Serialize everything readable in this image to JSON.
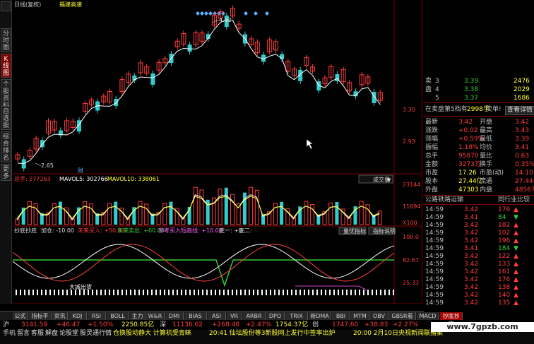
{
  "window": {
    "title_prefix": "日线(复权)",
    "stock_name": "福建高速"
  },
  "side_tabs": [
    {
      "label": "分\n时\n图",
      "active": false
    },
    {
      "label": "K\n线\n图",
      "active": true
    },
    {
      "label": "个\n股\n资\n料",
      "active": false
    },
    {
      "label": "自\n选\n股",
      "active": false
    },
    {
      "label": "综\n合\n排\n名",
      "active": false
    },
    {
      "label": "更\n多",
      "active": false
    }
  ],
  "price_axis": {
    "labels": [
      "4.32",
      "3.30",
      "2.93",
      "2.65"
    ],
    "right_labels": [
      "3.30",
      "2.93"
    ]
  },
  "volume_panel": {
    "header": "总手: 277263  MAVOL5: 302766  MAVOL10: 338061",
    "total_label": "总手: 277263",
    "ma5_label": "MAVOL5: 302766",
    "ma10_label": "MAVOL10: 338061",
    "axis": [
      "23144",
      "11694",
      "X100"
    ],
    "dropdown": "成交量",
    "badge": "财"
  },
  "indicator_panel": {
    "name": "抄底抄底",
    "add_label": "加仓: -10.00",
    "buy1": "未来买入: +50.00",
    "sell1": "未来卖出: +60.00",
    "buy2": "参考买入短趋线: +10.00",
    "low1": "底一: +0",
    "low2": "底二:",
    "btn_params": "量优指标",
    "btn_help": "指标说明",
    "axis": [
      "100.0",
      "62.67",
      "25.33"
    ],
    "annotation": "大城出货"
  },
  "x_axis": {
    "labels": [
      "10",
      "11",
      "12",
      "01",
      "02"
    ]
  },
  "right_panel": {
    "ask": [
      {
        "side": "卖",
        "level": "3",
        "price": "3.39",
        "vol": "2476"
      },
      {
        "side": "",
        "level": "4",
        "price": "3.38",
        "vol": "2029"
      },
      {
        "side": "",
        "level": "5",
        "price": "3.37",
        "vol": "1686"
      }
    ],
    "queue": {
      "text": "在卖盘第5档有",
      "count": "2998手",
      "sell1": "卖单!",
      "btn": "查看详情"
    },
    "stats": [
      {
        "l1": "最新",
        "v1": "3.42",
        "l2": "开盘",
        "v2": "3.42"
      },
      {
        "l1": "涨跌",
        "v1": "+0.02",
        "l2": "最高",
        "v2": "3.43"
      },
      {
        "l1": "涨幅",
        "v1": "+0.59%",
        "l2": "最低",
        "v2": "3.39"
      },
      {
        "l1": "振幅",
        "v1": "1.18%",
        "l2": "均价",
        "v2": "3.41"
      },
      {
        "l1": "总手",
        "v1": "95870",
        "l2": "量比",
        "v2": "0.63"
      },
      {
        "l1": "金额",
        "v1": "3273万",
        "l2": "换手",
        "v2": "0.35%"
      },
      {
        "l1": "市盈",
        "v1": "17.26",
        "l2": "市盈(动)",
        "v2": "14.10"
      },
      {
        "l1": "股本",
        "v1": "27.44亿",
        "l2": "流通",
        "v2": "27.44亿"
      },
      {
        "l1": "外盘",
        "v1": "47303",
        "l2": "内盘",
        "v2": "48567"
      }
    ],
    "industry": {
      "name": "公路铁路运输",
      "compare": "同行业比较"
    },
    "ticks": [
      {
        "time": "14:59",
        "price": "3.42",
        "vol": "176",
        "dir": "up"
      },
      {
        "time": "14:59",
        "price": "3.41",
        "vol": "84",
        "dir": "down"
      },
      {
        "time": "14:59",
        "price": "3.42",
        "vol": "182",
        "dir": "up"
      },
      {
        "time": "14:59",
        "price": "3.42",
        "vol": "102",
        "dir": "up"
      },
      {
        "time": "14:59",
        "price": "3.42",
        "vol": "196",
        "dir": "up"
      },
      {
        "time": "14:59",
        "price": "3.41",
        "vol": "184",
        "dir": "down"
      },
      {
        "time": "14:59",
        "price": "3.42",
        "vol": "122",
        "dir": "up"
      },
      {
        "time": "14:59",
        "price": "3.42",
        "vol": "133",
        "dir": "up"
      },
      {
        "time": "14:59",
        "price": "3.42",
        "vol": "161",
        "dir": "up"
      },
      {
        "time": "14:59",
        "price": "3.42",
        "vol": "176",
        "dir": "up"
      },
      {
        "time": "14:59",
        "price": "3.42",
        "vol": "138",
        "dir": "up"
      },
      {
        "time": "14:59",
        "price": "3.42",
        "vol": "140",
        "dir": "up"
      },
      {
        "time": "14:59",
        "price": "3.42",
        "vol": "135",
        "dir": "up"
      }
    ]
  },
  "bottom_tabs": [
    {
      "label": "公式",
      "active": false
    },
    {
      "label": "指标平台",
      "active": false
    },
    {
      "label": "资讯",
      "active": false
    },
    {
      "label": "KDJ",
      "active": false
    },
    {
      "label": "RSI",
      "active": false
    },
    {
      "label": "BOLL",
      "active": false
    },
    {
      "label": "主力",
      "active": false
    },
    {
      "label": "W&R",
      "active": false
    },
    {
      "label": "DMI",
      "active": false
    },
    {
      "label": "BIAS",
      "active": false
    },
    {
      "label": "ASI",
      "active": false
    },
    {
      "label": "VR",
      "active": false
    },
    {
      "label": "ARBR",
      "active": false
    },
    {
      "label": "DPO",
      "active": false
    },
    {
      "label": "TRIX",
      "active": false
    },
    {
      "label": "新DMA",
      "active": false
    },
    {
      "label": "BBI",
      "active": false
    },
    {
      "label": "MTM",
      "active": false
    },
    {
      "label": "OBV",
      "active": false
    },
    {
      "label": "GBSR看",
      "active": false
    },
    {
      "label": "MACD",
      "active": false
    },
    {
      "label": "抄底抄底",
      "active": true
    }
  ],
  "index_bar": {
    "sh_label": "沪",
    "sh_value": "3141.59",
    "sh_change": "+46.47",
    "sh_pct": "+1.50%",
    "sh_amount": "2250.85亿",
    "sz_label": "深",
    "sz_value": "11136.62",
    "sz_change": "+268.48",
    "sz_pct": "+2.47%",
    "sz_amount": "1754.37亿",
    "cy_label": "创",
    "cy_value": "1747.60",
    "cy_change": "+38.83",
    "cy_pct": "+2.27%"
  },
  "status_bar": {
    "items": [
      "手机",
      "留言",
      "客服",
      "解盘",
      "论股堂",
      "股灵通",
      "行情"
    ],
    "news1": "仓换股动静大 计算机受青睐",
    "news2": "20:41 仙坛股份等3新股网上发行中签率出炉",
    "news3": "20:00 2月10日央视新闻联播集"
  },
  "watermark": "www.7gpzb.com",
  "colors": {
    "up": "#ff3c3c",
    "down": "#33cccc",
    "ma_yellow": "#ffff33",
    "ma_white": "#ffffff"
  }
}
